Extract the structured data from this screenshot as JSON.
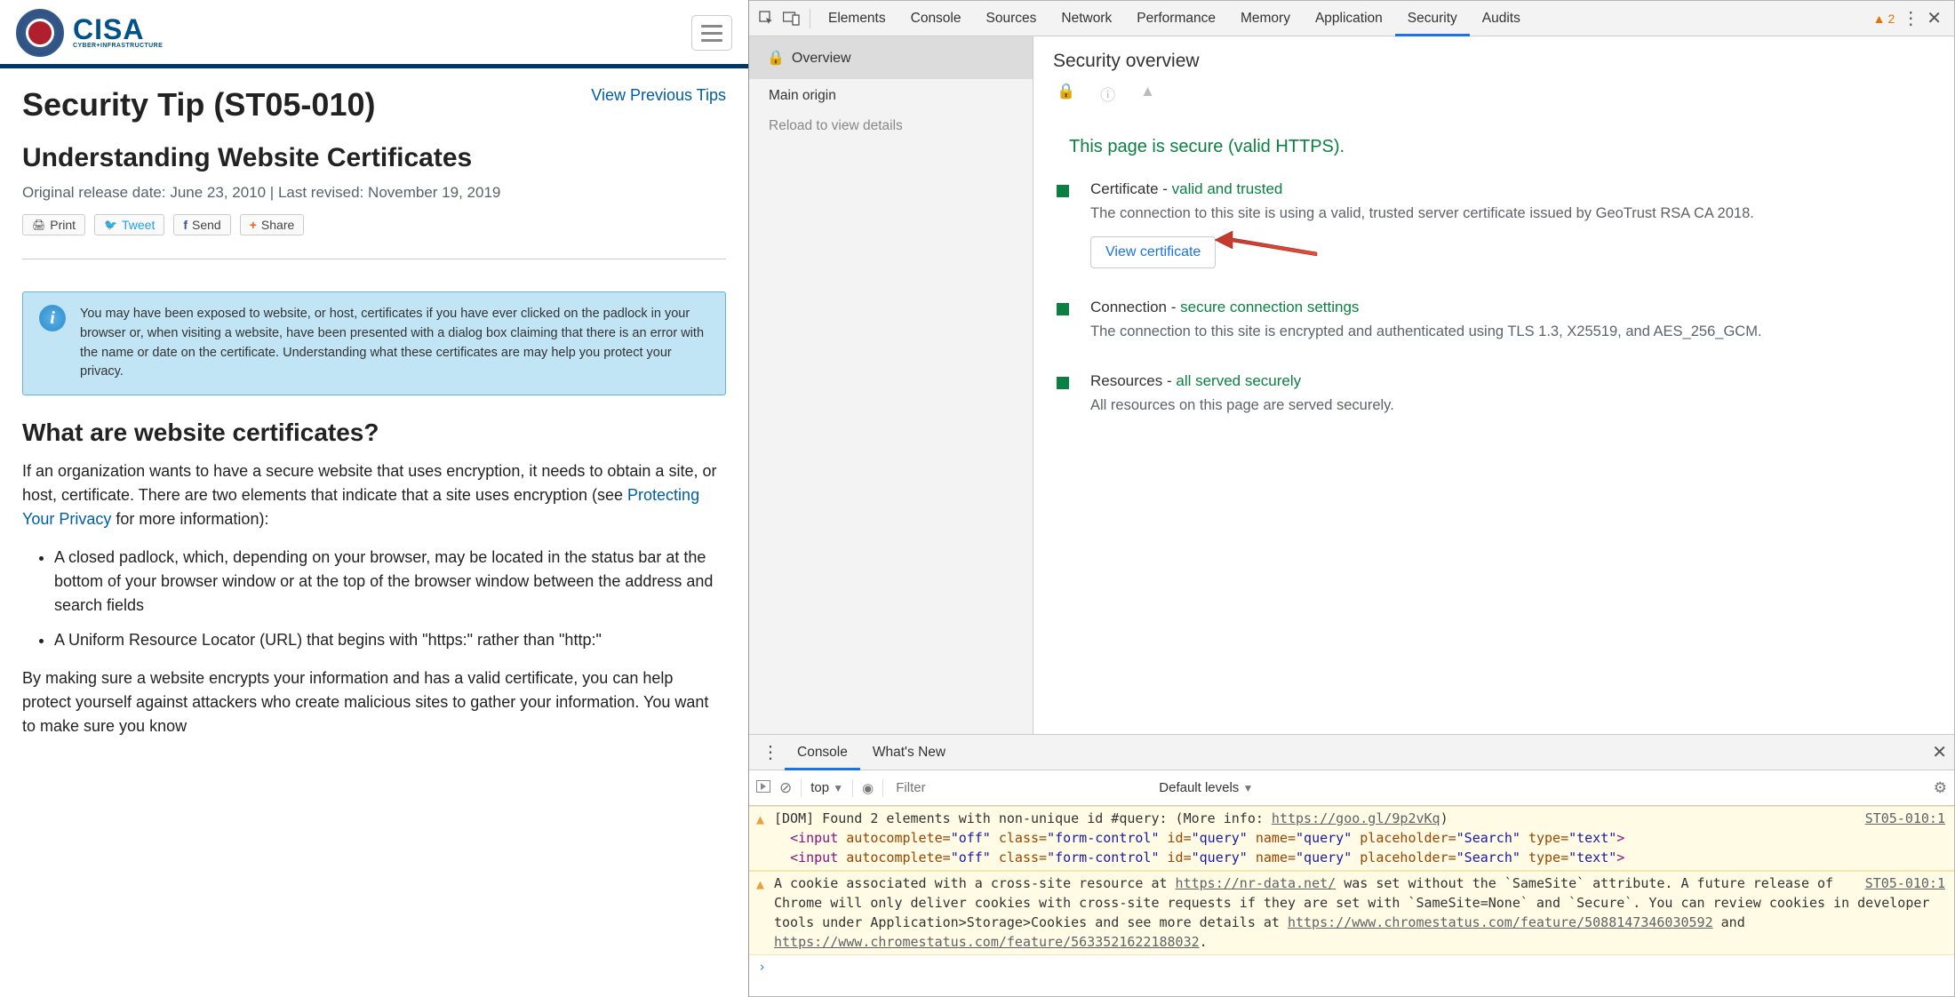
{
  "cisa": {
    "logo_text": "CISA",
    "logo_sub": "CYBER+INFRASTRUCTURE",
    "title": "Security Tip (ST05-010)",
    "prev_link": "View Previous Tips",
    "subtitle": "Understanding Website Certificates",
    "release": "Original release date: June 23, 2010 | Last revised: November 19, 2019",
    "share": {
      "print": "Print",
      "tweet": "Tweet",
      "send": "Send",
      "share": "Share"
    },
    "info_box": "You may have been exposed to website, or host, certificates if you have ever clicked on the padlock in your browser or, when visiting a website, have been presented with a dialog box claiming that there is an error with the name or date on the certificate. Understanding what these certificates are may help you protect your privacy.",
    "h2": "What are website certificates?",
    "p1a": "If an organization wants to have a secure website that uses encryption, it needs to obtain a site, or host, certificate. There are two elements that indicate that a site uses encryption (see ",
    "p1link": "Protecting Your Privacy",
    "p1b": " for more information):",
    "li1": "A closed padlock, which, depending on your browser, may be located in the status bar at the bottom of your browser window or at the top of the browser window between the address and search fields",
    "li2": "A Uniform Resource Locator (URL) that begins with \"https:\" rather than \"http:\"",
    "p2": "By making sure a website encrypts your information and has a valid certificate, you can help protect yourself against attackers who create malicious sites to gather your information. You want to make sure you know"
  },
  "devtools": {
    "tabs": [
      "Elements",
      "Console",
      "Sources",
      "Network",
      "Performance",
      "Memory",
      "Application",
      "Security",
      "Audits"
    ],
    "active_tab": "Security",
    "warn_count": "2",
    "sidebar": {
      "overview": "Overview",
      "main_origin": "Main origin",
      "reload": "Reload to view details"
    },
    "sec": {
      "title": "Security overview",
      "secure_msg": "This page is secure (valid HTTPS).",
      "cert_head_a": "Certificate - ",
      "cert_head_b": "valid and trusted",
      "cert_desc": "The connection to this site is using a valid, trusted server certificate issued by GeoTrust RSA CA 2018.",
      "view_cert": "View certificate",
      "conn_head_a": "Connection - ",
      "conn_head_b": "secure connection settings",
      "conn_desc": "The connection to this site is encrypted and authenticated using TLS 1.3, X25519, and AES_256_GCM.",
      "res_head_a": "Resources - ",
      "res_head_b": "all served securely",
      "res_desc": "All resources on this page are served securely."
    },
    "drawer": {
      "tabs": {
        "console": "Console",
        "whatsnew": "What's New"
      },
      "context": "top",
      "filter_placeholder": "Filter",
      "levels": "Default levels",
      "log1": {
        "prefix": "[DOM] Found 2 elements with non-unique id #query: (More info: ",
        "link": "https://goo.gl/9p2vKq",
        "suffix": ")",
        "source": "ST05-010:1",
        "input1_open": "<input ",
        "input1_attrs": "autocomplete=\"off\" class=\"form-control\" id=\"query\" name=\"query\" placeholder=\"Search\" type=\"text\"",
        "input_close": ">",
        "input2_open": "<input ",
        "input2_attrs": "autocomplete=\"off\" class=\"form-control\" id=\"query\" name=\"query\" placeholder=\"Search\" type=\"text\""
      },
      "log2": {
        "a": "A cookie associated with a cross-site resource at ",
        "link1": "https://nr-data.net/",
        "b": " was set without the `SameSite` attribute. A future release of Chrome will only deliver cookies with cross-site requests if they are set with `SameSite=None` and `Secure`. You can review cookies in developer tools under Application>Storage>Cookies and see more details at ",
        "link2": "https://www.chromestatus.com/feature/5088147346030592",
        "c": " and ",
        "link3": "https://www.chromestatus.com/feature/5633521622188032",
        "d": ".",
        "source": "ST05-010:1"
      }
    }
  }
}
